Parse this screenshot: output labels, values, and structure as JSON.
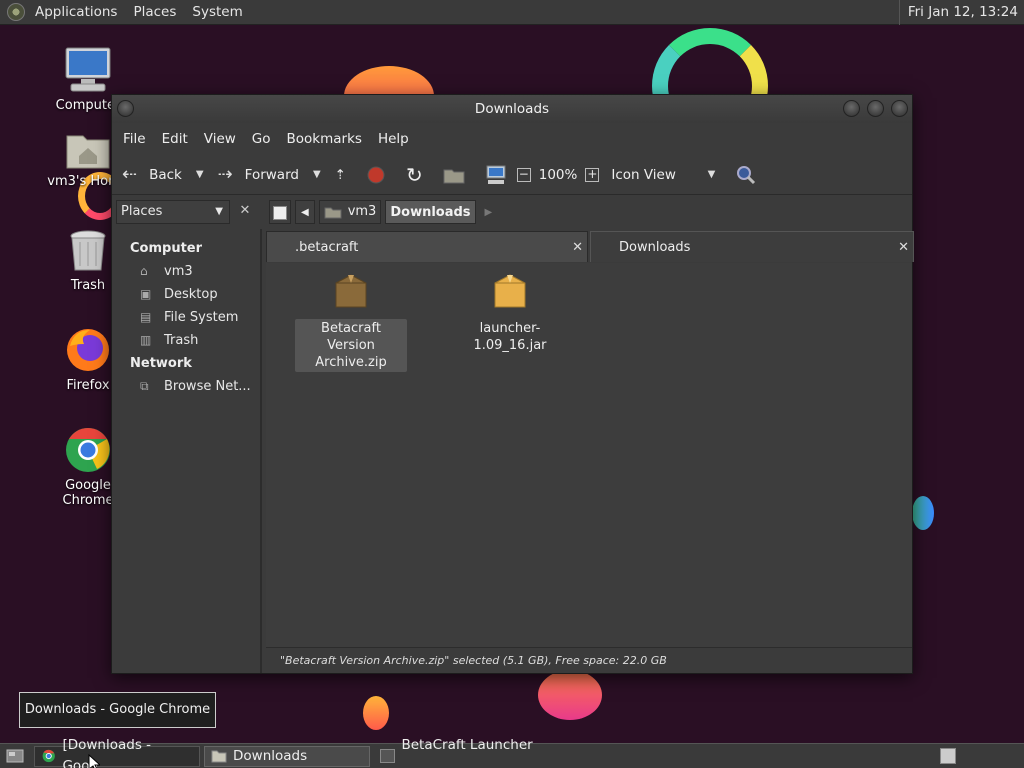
{
  "top_panel": {
    "menus": [
      "Applications",
      "Places",
      "System"
    ],
    "clock": "Fri Jan 12, 13:24"
  },
  "desktop_icons": [
    {
      "label": "Computer",
      "icon": "computer-icon"
    },
    {
      "label": "vm3's Home",
      "icon": "home-folder-icon"
    },
    {
      "label": "Trash",
      "icon": "trash-icon"
    },
    {
      "label": "Firefox",
      "icon": "firefox-icon"
    },
    {
      "label": "Google Chrome",
      "icon": "chrome-icon"
    }
  ],
  "window": {
    "title": "Downloads",
    "menubar": [
      "File",
      "Edit",
      "View",
      "Go",
      "Bookmarks",
      "Help"
    ],
    "toolbar": {
      "back": "Back",
      "forward": "Forward",
      "zoom": "100%",
      "view_mode": "Icon View"
    },
    "sidebar_combo": "Places",
    "path": {
      "home": "vm3",
      "current": "Downloads"
    },
    "sidebar": {
      "computer_header": "Computer",
      "computer_items": [
        "vm3",
        "Desktop",
        "File System",
        "Trash"
      ],
      "network_header": "Network",
      "network_items": [
        "Browse Net..."
      ]
    },
    "tabs": [
      {
        "label": ".betacraft"
      },
      {
        "label": "Downloads"
      }
    ],
    "files": [
      {
        "name_line1": "Betacraft Version",
        "name_line2": "Archive.zip",
        "selected": true
      },
      {
        "name_line1": "launcher-1.09_16.jar",
        "name_line2": "",
        "selected": false
      }
    ],
    "status": "\"Betacraft Version Archive.zip\" selected (5.1 GB), Free space: 22.0 GB"
  },
  "tooltip": "Downloads - Google Chrome",
  "taskbar": {
    "tasks": [
      "[Downloads - Goog...",
      "Downloads",
      "BetaCraft Launcher ..."
    ]
  },
  "colors": {
    "desktop_bg": "#2a0f24",
    "window_bg": "#3b3b3b",
    "record_red": "#c0392b"
  }
}
